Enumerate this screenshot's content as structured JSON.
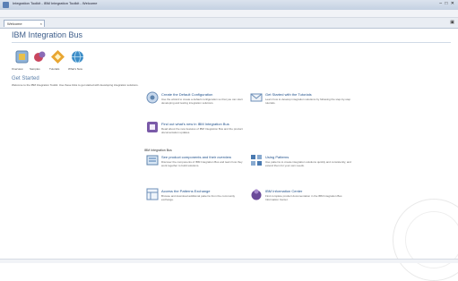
{
  "window": {
    "title": "Integration Toolkit - IBM Integration Toolkit - Welcome"
  },
  "menubar": [
    "File",
    "Edit",
    "Navigate",
    "Search",
    "Project",
    "Run",
    "Window",
    "Help"
  ],
  "tab": {
    "label": "Welcome",
    "close": "×"
  },
  "brand": "IBM Integration Bus",
  "toolbar": [
    {
      "label": "Overview",
      "icon": "overview-icon"
    },
    {
      "label": "Samples",
      "icon": "samples-icon"
    },
    {
      "label": "Tutorials",
      "icon": "tutorials-icon"
    },
    {
      "label": "What's New",
      "icon": "whats-new-icon"
    }
  ],
  "get_started": {
    "title": "Get Started",
    "desc": "Welcome to the IBM Integration Toolkit. Use these links to get started with developing integration solutions."
  },
  "cards": [
    {
      "title": "Create the Default Configuration",
      "desc": "Use the wizard to create a default configuration so that you can start developing and testing integration solutions.",
      "icon": "default-config-icon"
    },
    {
      "title": "Get Started with the Tutorials",
      "desc": "Learn how to develop integration solutions by following the step-by-step tutorials.",
      "icon": "mail-icon"
    },
    {
      "title": "Find out what's new in IBM Integration Bus",
      "desc": "Read about the new features of IBM Integration Bus and the product documentation updates.",
      "icon": "whats-new-card-icon"
    },
    {
      "title": "See product components and their overview",
      "desc": "Discover the components of IBM Integration Bus and learn how they work together to build solutions.",
      "icon": "components-icon"
    },
    {
      "title": "Using Patterns",
      "desc": "Use patterns to create integration solutions quickly and consistently, and extend them for your own needs.",
      "icon": "patterns-icon"
    },
    {
      "title": "Access the Patterns Exchange",
      "desc": "Browse and download additional patterns from the community exchange.",
      "icon": "exchange-icon"
    },
    {
      "title": "IBM Information Center",
      "desc": "Find complete product documentation in the IBM Integration Bus Information Center.",
      "icon": "info-center-icon"
    }
  ],
  "section_label": "IBM Integration Bus"
}
